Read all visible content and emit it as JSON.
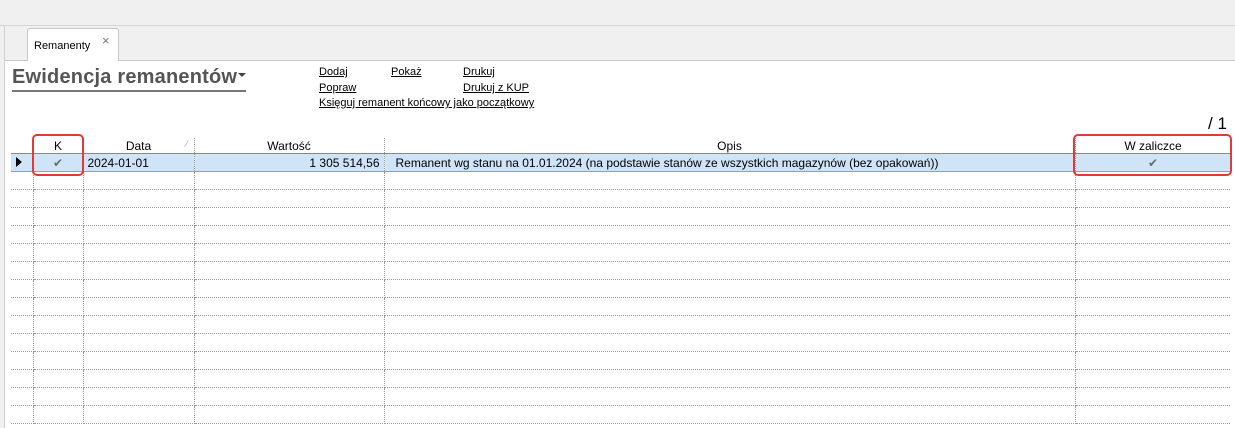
{
  "tab": {
    "label": "Remanenty",
    "close_icon": "×"
  },
  "page_title": "Ewidencja remanentów",
  "actions": {
    "dodaj": "Dodaj",
    "pokaz": "Pokaż",
    "drukuj": "Drukuj",
    "popraw": "Popraw",
    "drukuj_kup": "Drukuj z KUP",
    "ksieguj": "Księguj remanent końcowy jako początkowy"
  },
  "page_count": "/ 1",
  "table": {
    "columns": [
      "K",
      "Data",
      "Wartość",
      "Opis",
      "W zaliczce"
    ],
    "rows": [
      {
        "k": "✔",
        "data": "2024-01-01",
        "wartosc": "1 305 514,56",
        "opis": "Remanent wg stanu na 01.01.2024 (na podstawie stanów ze wszystkich magazynów (bez opakowań))",
        "w_zaliczce": "✔"
      }
    ]
  },
  "colors": {
    "selected_row": "#cfe5f7",
    "highlight": "#e53935",
    "title": "#555555"
  },
  "icons": {
    "row_indicator": "triangle-right-icon",
    "check": "check-icon",
    "close": "close-icon"
  }
}
